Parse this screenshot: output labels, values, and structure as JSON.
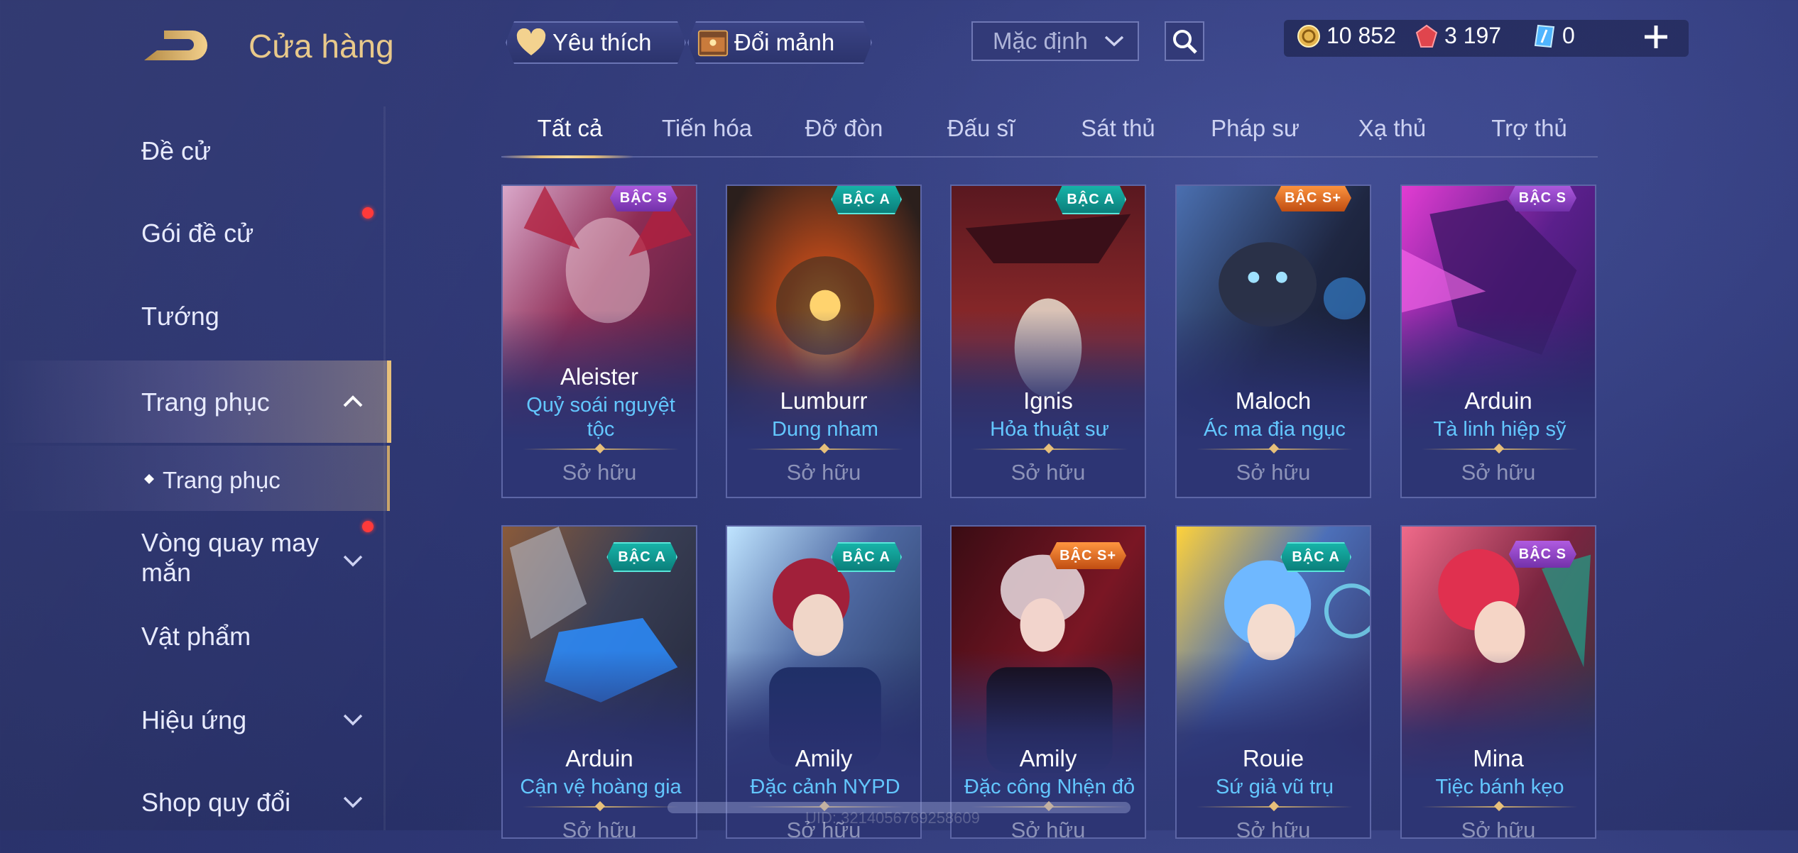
{
  "header": {
    "title": "Cửa hàng",
    "favorite_label": "Yêu thích",
    "shard_exchange_label": "Đổi mảnh",
    "sort_value": "Mặc định"
  },
  "currencies": {
    "gold": "10 852",
    "ruby": "3 197",
    "voucher": "0"
  },
  "sidebar": {
    "items": [
      {
        "label": "Đề cử"
      },
      {
        "label": "Gói đề cử"
      },
      {
        "label": "Tướng"
      },
      {
        "label": "Trang phục"
      },
      {
        "label": "Trang phục"
      },
      {
        "label": "Vòng quay may mắn"
      },
      {
        "label": "Vật phẩm"
      },
      {
        "label": "Hiệu ứng"
      },
      {
        "label": "Shop quy đổi"
      }
    ]
  },
  "tabs": [
    "Tất cả",
    "Tiến hóa",
    "Đỡ đòn",
    "Đấu sĩ",
    "Sát thủ",
    "Pháp sư",
    "Xạ thủ",
    "Trợ thủ"
  ],
  "cards": [
    {
      "hero": "Aleister",
      "skin": "Quỷ soái nguyệt tộc",
      "badge": "BẬC S",
      "status": "Sở hữu"
    },
    {
      "hero": "Lumburr",
      "skin": "Dung nham",
      "badge": "BẬC A",
      "status": "Sở hữu"
    },
    {
      "hero": "Ignis",
      "skin": "Hỏa thuật sư",
      "badge": "BẬC A",
      "status": "Sở hữu"
    },
    {
      "hero": "Maloch",
      "skin": "Ác ma địa ngục",
      "badge": "BẬC S+",
      "status": "Sở hữu"
    },
    {
      "hero": "Arduin",
      "skin": "Tà linh hiệp sỹ",
      "badge": "BẬC S",
      "status": "Sở hữu"
    },
    {
      "hero": "Arduin",
      "skin": "Cận vệ hoàng gia",
      "badge": "BẬC A",
      "status": "Sở hữu"
    },
    {
      "hero": "Amily",
      "skin": "Đặc cảnh NYPD",
      "badge": "BẬC A",
      "status": "Sở hữu"
    },
    {
      "hero": "Amily",
      "skin": "Đặc công Nhện đỏ",
      "badge": "BẬC S+",
      "status": "Sở hữu"
    },
    {
      "hero": "Rouie",
      "skin": "Sứ giả vũ trụ",
      "badge": "BẬC A",
      "status": "Sở hữu"
    },
    {
      "hero": "Mina",
      "skin": "Tiệc bánh kẹo",
      "badge": "BẬC S",
      "status": "Sở hữu"
    }
  ],
  "uid_text": "UID: 3214056769258609",
  "colors": {
    "accent_gold": "#e7c07a",
    "skin_name_blue": "#63c7ff",
    "badge_a": "#17b3a8",
    "badge_s": "#b05be0",
    "badge_s_plus": "#ff9640",
    "notification_red": "#ff3a3a"
  }
}
